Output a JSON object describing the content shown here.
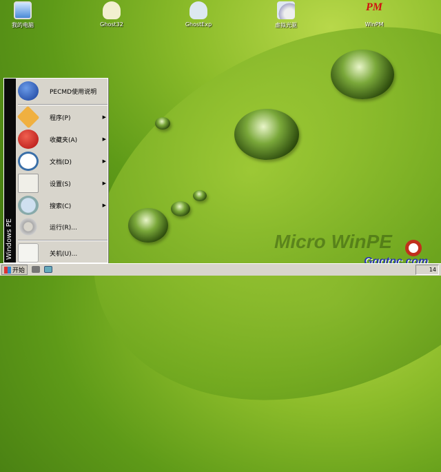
{
  "desktop": {
    "icons": [
      {
        "label": "我的电脑",
        "icon": "computer-icon"
      },
      {
        "label": "Ghost32",
        "icon": "ghost-icon"
      },
      {
        "label": "GhostExp",
        "icon": "ghost-search-icon"
      },
      {
        "label": "虚拟光驱",
        "icon": "virtual-drive-icon"
      },
      {
        "label": "WinPM",
        "icon": "winpm-icon"
      }
    ],
    "watermark": "Micro WinPE",
    "site": "Gqgtpc.com"
  },
  "start_menu": {
    "sidebar_label": "Windows PE",
    "items": [
      {
        "label": "PECMD使用说明",
        "icon": "help-icon",
        "submenu": false
      },
      {
        "label": "程序(P)",
        "icon": "programs-icon",
        "submenu": true
      },
      {
        "label": "收藏夹(A)",
        "icon": "heart-icon",
        "submenu": true
      },
      {
        "label": "文档(D)",
        "icon": "clock-icon",
        "submenu": true
      },
      {
        "label": "设置(S)",
        "icon": "settings-icon",
        "submenu": true
      },
      {
        "label": "搜索(C)",
        "icon": "magnifier-icon",
        "submenu": true
      },
      {
        "label": "运行(R)...",
        "icon": "gears-icon",
        "submenu": false
      },
      {
        "label": "关机(U)...",
        "icon": "shutdown-icon",
        "submenu": false
      }
    ],
    "arrow": "▶"
  },
  "taskbar": {
    "start_label": "开始",
    "clock": "14"
  }
}
